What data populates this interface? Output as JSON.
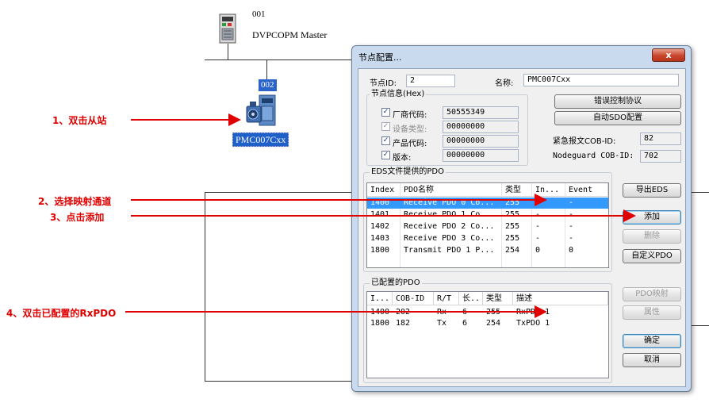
{
  "network": {
    "master_node_number": "001",
    "master_name": "DVPCOPM Master",
    "slave_node_number": "002",
    "slave_name": "PMC007Cxx"
  },
  "annotations": [
    "1、双击从站",
    "2、选择映射通道",
    "3、点击添加",
    "4、双击已配置的RxPDO"
  ],
  "dialog": {
    "title": "节点配置...",
    "close_glyph": "x",
    "node_id_label": "节点ID:",
    "node_id_value": "2",
    "name_label": "名称:",
    "name_value": "PMC007Cxx",
    "node_info_title": "节点信息(Hex)",
    "info_fields": [
      {
        "label": "厂商代码:",
        "value": "50555349",
        "checked": true,
        "disabled": false
      },
      {
        "label": "设备类型:",
        "value": "00000000",
        "checked": true,
        "disabled": true
      },
      {
        "label": "产品代码:",
        "value": "00000000",
        "checked": true,
        "disabled": false
      },
      {
        "label": "版本:",
        "value": "00000000",
        "checked": true,
        "disabled": false
      }
    ],
    "check_glyph": "✓",
    "error_protocol_button": "错误控制协议",
    "auto_sdo_button": "自动SDO配置",
    "emcy_label": "紧急报文COB-ID:",
    "emcy_value": "82",
    "nodeguard_label": "Nodeguard COB-ID:",
    "nodeguard_value": "702",
    "eds_group_title": "EDS文件提供的PDO",
    "eds_columns": [
      "Index",
      "PDO名称",
      "类型",
      "In...",
      "Event"
    ],
    "eds_rows": [
      {
        "index": "1400",
        "name": "Receive PDO 0 Co...",
        "type": "255",
        "inhibit": "-",
        "event": "-",
        "selected": true
      },
      {
        "index": "1401",
        "name": "Receive PDO 1 Co...",
        "type": "255",
        "inhibit": "-",
        "event": "-",
        "selected": false
      },
      {
        "index": "1402",
        "name": "Receive PDO 2 Co...",
        "type": "255",
        "inhibit": "-",
        "event": "-",
        "selected": false
      },
      {
        "index": "1403",
        "name": "Receive PDO 3 Co...",
        "type": "255",
        "inhibit": "-",
        "event": "-",
        "selected": false
      },
      {
        "index": "1800",
        "name": "Transmit PDO 1 P...",
        "type": "254",
        "inhibit": "0",
        "event": "0",
        "selected": false
      }
    ],
    "export_eds_button": "导出EDS",
    "add_button": "添加",
    "delete_button": "删除",
    "custom_pdo_button": "自定义PDO",
    "configured_group_title": "已配置的PDO",
    "configured_columns": [
      "I...",
      "COB-ID",
      "R/T",
      "长..",
      "类型",
      "描述"
    ],
    "configured_rows": [
      {
        "index": "1400",
        "cob_id": "202",
        "rt": "Rx",
        "len": "6",
        "type": "255",
        "desc": "RxPDO 1"
      },
      {
        "index": "1800",
        "cob_id": "182",
        "rt": "Tx",
        "len": "6",
        "type": "254",
        "desc": "TxPDO 1"
      }
    ],
    "pdo_mapping_button": "PDO映射",
    "properties_button": "属性",
    "ok_button": "确定",
    "cancel_button": "取消"
  },
  "colors": {
    "annotation": "#e00000",
    "selection": "#3399ff",
    "slave_label_bg": "#1f5fc8"
  }
}
